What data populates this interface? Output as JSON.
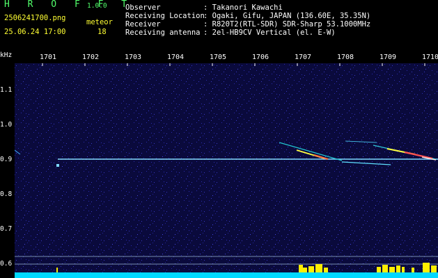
{
  "app": {
    "name": "H R O F F T",
    "version": "1.0.0",
    "filename": "2506241700.png",
    "datetime": "25.06.24 17:00",
    "meteor_label": "meteor",
    "meteor_count": "18"
  },
  "info": [
    {
      "label": "Observer",
      "value": ": Takanori Kawachi"
    },
    {
      "label": "Receiving Location",
      "value": ": Ogaki, Gifu, JAPAN (136.60E, 35.35N)"
    },
    {
      "label": "Receiver",
      "value": ": R820T2(RTL-SDR) SDR-Sharp 53.1000MHz"
    },
    {
      "label": "Receiving antenna",
      "value": ": 2el-HB9CV Vertical (el. E-W)"
    }
  ],
  "time_axis": [
    "1701",
    "1702",
    "1703",
    "1704",
    "1705",
    "1706",
    "1707",
    "1708",
    "1709",
    "1710"
  ],
  "freq_axis": {
    "unit": "kHz",
    "ticks": [
      "1.1",
      "1.0",
      "0.9",
      "0.8",
      "0.7",
      "0.6"
    ]
  },
  "colors": {
    "background": "#0a0a3c",
    "carrier": "#7dd8ff",
    "meteor_hot": "#ff5050",
    "meteor_warm": "#ffff40",
    "baseline": "#00ffff",
    "activity": "#ffee00",
    "title_green": "#52ff6b",
    "label_yellow": "#ffff33"
  }
}
